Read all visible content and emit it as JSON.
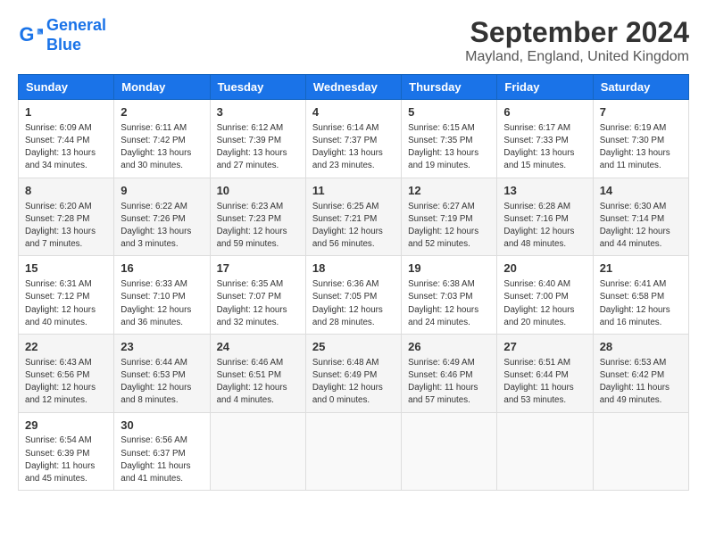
{
  "header": {
    "logo_line1": "General",
    "logo_line2": "Blue",
    "main_title": "September 2024",
    "subtitle": "Mayland, England, United Kingdom"
  },
  "days_of_week": [
    "Sunday",
    "Monday",
    "Tuesday",
    "Wednesday",
    "Thursday",
    "Friday",
    "Saturday"
  ],
  "weeks": [
    [
      {
        "day": "1",
        "info": "Sunrise: 6:09 AM\nSunset: 7:44 PM\nDaylight: 13 hours\nand 34 minutes."
      },
      {
        "day": "2",
        "info": "Sunrise: 6:11 AM\nSunset: 7:42 PM\nDaylight: 13 hours\nand 30 minutes."
      },
      {
        "day": "3",
        "info": "Sunrise: 6:12 AM\nSunset: 7:39 PM\nDaylight: 13 hours\nand 27 minutes."
      },
      {
        "day": "4",
        "info": "Sunrise: 6:14 AM\nSunset: 7:37 PM\nDaylight: 13 hours\nand 23 minutes."
      },
      {
        "day": "5",
        "info": "Sunrise: 6:15 AM\nSunset: 7:35 PM\nDaylight: 13 hours\nand 19 minutes."
      },
      {
        "day": "6",
        "info": "Sunrise: 6:17 AM\nSunset: 7:33 PM\nDaylight: 13 hours\nand 15 minutes."
      },
      {
        "day": "7",
        "info": "Sunrise: 6:19 AM\nSunset: 7:30 PM\nDaylight: 13 hours\nand 11 minutes."
      }
    ],
    [
      {
        "day": "8",
        "info": "Sunrise: 6:20 AM\nSunset: 7:28 PM\nDaylight: 13 hours\nand 7 minutes."
      },
      {
        "day": "9",
        "info": "Sunrise: 6:22 AM\nSunset: 7:26 PM\nDaylight: 13 hours\nand 3 minutes."
      },
      {
        "day": "10",
        "info": "Sunrise: 6:23 AM\nSunset: 7:23 PM\nDaylight: 12 hours\nand 59 minutes."
      },
      {
        "day": "11",
        "info": "Sunrise: 6:25 AM\nSunset: 7:21 PM\nDaylight: 12 hours\nand 56 minutes."
      },
      {
        "day": "12",
        "info": "Sunrise: 6:27 AM\nSunset: 7:19 PM\nDaylight: 12 hours\nand 52 minutes."
      },
      {
        "day": "13",
        "info": "Sunrise: 6:28 AM\nSunset: 7:16 PM\nDaylight: 12 hours\nand 48 minutes."
      },
      {
        "day": "14",
        "info": "Sunrise: 6:30 AM\nSunset: 7:14 PM\nDaylight: 12 hours\nand 44 minutes."
      }
    ],
    [
      {
        "day": "15",
        "info": "Sunrise: 6:31 AM\nSunset: 7:12 PM\nDaylight: 12 hours\nand 40 minutes."
      },
      {
        "day": "16",
        "info": "Sunrise: 6:33 AM\nSunset: 7:10 PM\nDaylight: 12 hours\nand 36 minutes."
      },
      {
        "day": "17",
        "info": "Sunrise: 6:35 AM\nSunset: 7:07 PM\nDaylight: 12 hours\nand 32 minutes."
      },
      {
        "day": "18",
        "info": "Sunrise: 6:36 AM\nSunset: 7:05 PM\nDaylight: 12 hours\nand 28 minutes."
      },
      {
        "day": "19",
        "info": "Sunrise: 6:38 AM\nSunset: 7:03 PM\nDaylight: 12 hours\nand 24 minutes."
      },
      {
        "day": "20",
        "info": "Sunrise: 6:40 AM\nSunset: 7:00 PM\nDaylight: 12 hours\nand 20 minutes."
      },
      {
        "day": "21",
        "info": "Sunrise: 6:41 AM\nSunset: 6:58 PM\nDaylight: 12 hours\nand 16 minutes."
      }
    ],
    [
      {
        "day": "22",
        "info": "Sunrise: 6:43 AM\nSunset: 6:56 PM\nDaylight: 12 hours\nand 12 minutes."
      },
      {
        "day": "23",
        "info": "Sunrise: 6:44 AM\nSunset: 6:53 PM\nDaylight: 12 hours\nand 8 minutes."
      },
      {
        "day": "24",
        "info": "Sunrise: 6:46 AM\nSunset: 6:51 PM\nDaylight: 12 hours\nand 4 minutes."
      },
      {
        "day": "25",
        "info": "Sunrise: 6:48 AM\nSunset: 6:49 PM\nDaylight: 12 hours\nand 0 minutes."
      },
      {
        "day": "26",
        "info": "Sunrise: 6:49 AM\nSunset: 6:46 PM\nDaylight: 11 hours\nand 57 minutes."
      },
      {
        "day": "27",
        "info": "Sunrise: 6:51 AM\nSunset: 6:44 PM\nDaylight: 11 hours\nand 53 minutes."
      },
      {
        "day": "28",
        "info": "Sunrise: 6:53 AM\nSunset: 6:42 PM\nDaylight: 11 hours\nand 49 minutes."
      }
    ],
    [
      {
        "day": "29",
        "info": "Sunrise: 6:54 AM\nSunset: 6:39 PM\nDaylight: 11 hours\nand 45 minutes."
      },
      {
        "day": "30",
        "info": "Sunrise: 6:56 AM\nSunset: 6:37 PM\nDaylight: 11 hours\nand 41 minutes."
      },
      null,
      null,
      null,
      null,
      null
    ]
  ]
}
